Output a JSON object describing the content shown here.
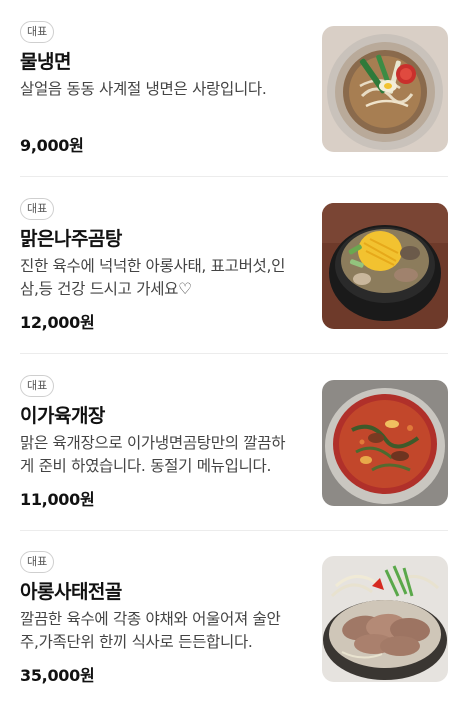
{
  "menu": {
    "items": [
      {
        "badge": "대표",
        "name": "물냉면",
        "description": "살얼음 동동 사계절 냉면은 사랑입니다.",
        "price": "9,000원",
        "image": "naengmyeon-photo"
      },
      {
        "badge": "대표",
        "name": "맑은나주곰탕",
        "description": "진한 육수에 넉넉한 아롱사태, 표고버섯,인삼,등 건강 드시고 가세요♡",
        "price": "12,000원",
        "image": "gomtang-photo"
      },
      {
        "badge": "대표",
        "name": "이가육개장",
        "description": "맑은 육개장으로 이가냉면곰탕만의 깔끔하게 준비 하였습니다. 동절기 메뉴입니다.",
        "price": "11,000원",
        "image": "yukgaejang-photo"
      },
      {
        "badge": "대표",
        "name": "아롱사태전골",
        "description": "깔끔한 육수에 각종 야채와 어울어져 술안주,가족단위 한끼 식사로 든든합니다.",
        "price": "35,000원",
        "image": "jeongol-photo"
      }
    ]
  }
}
